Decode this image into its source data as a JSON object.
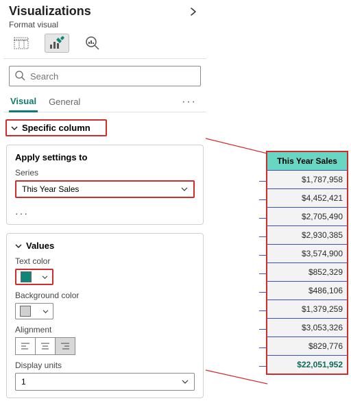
{
  "panel": {
    "title": "Visualizations",
    "subtitle": "Format visual"
  },
  "search": {
    "placeholder": "Search"
  },
  "tabs": {
    "visual": "Visual",
    "general": "General"
  },
  "expander": {
    "label": "Specific column"
  },
  "applySettings": {
    "title": "Apply settings to",
    "seriesLabel": "Series",
    "seriesValue": "This Year Sales"
  },
  "values": {
    "header": "Values",
    "textColorLabel": "Text color",
    "textColor": "#0f8677",
    "bgColorLabel": "Background color",
    "bgColor": "#d0d0d0",
    "alignmentLabel": "Alignment",
    "displayUnitsLabel": "Display units",
    "displayUnitsValue": "1"
  },
  "table": {
    "header": "This Year Sales",
    "rows": [
      "$1,787,958",
      "$4,452,421",
      "$2,705,490",
      "$2,930,385",
      "$3,574,900",
      "$852,329",
      "$486,106",
      "$1,379,259",
      "$3,053,326",
      "$829,776"
    ],
    "total": "$22,051,952"
  }
}
